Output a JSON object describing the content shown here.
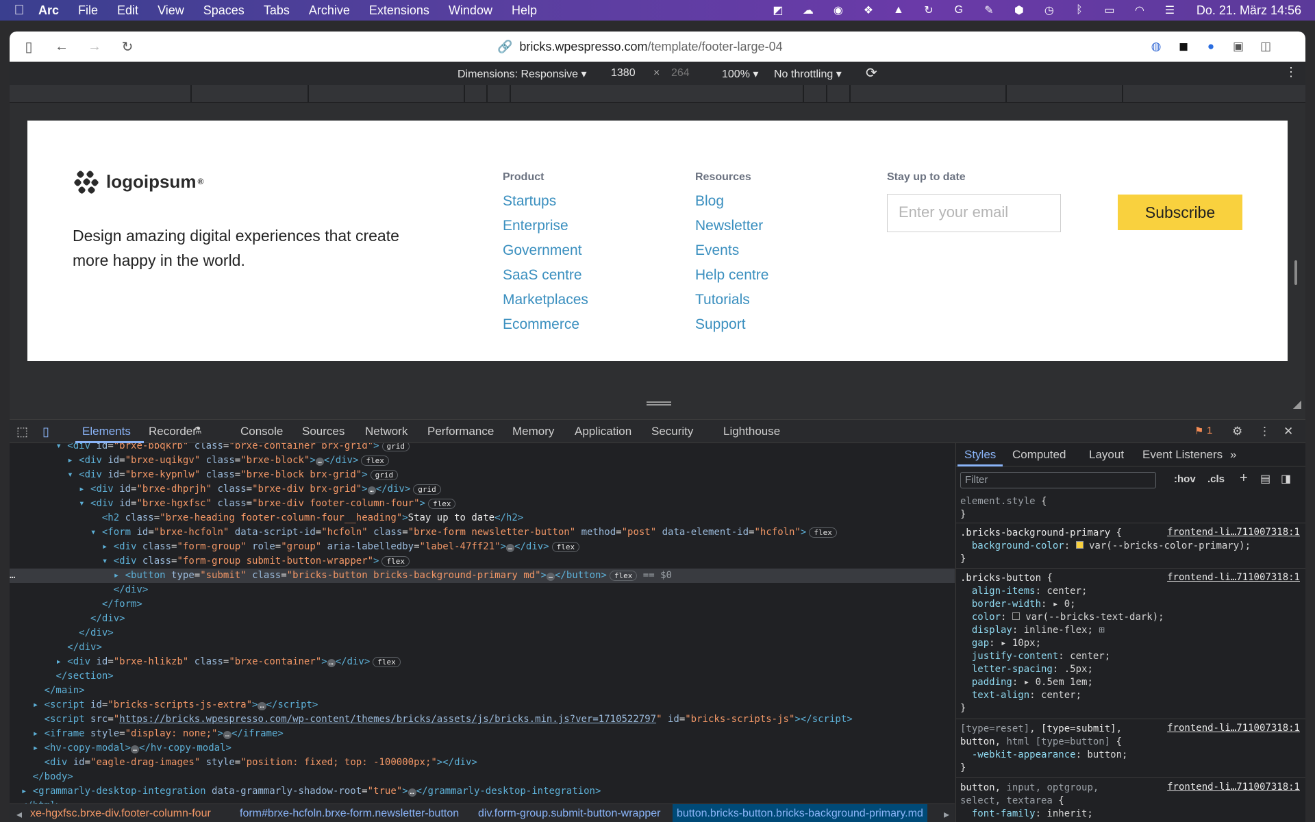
{
  "menubar": {
    "app": "Arc",
    "items": [
      "File",
      "Edit",
      "View",
      "Spaces",
      "Tabs",
      "Archive",
      "Extensions",
      "Window",
      "Help"
    ],
    "clock": "Do. 21. März  14:56"
  },
  "browser": {
    "url_host": "bricks.wpespresso.com",
    "url_path": "/template/footer-large-04"
  },
  "device_toolbar": {
    "dimensions": "Dimensions: Responsive ▾",
    "width": "1380",
    "times": "×",
    "height": "264",
    "zoom": "100% ▾",
    "throttle": "No throttling ▾"
  },
  "footer": {
    "logo": "logoipsum",
    "logo_mark": "®",
    "tagline": "Design amazing digital experiences that create more happy in the world.",
    "product_heading": "Product",
    "product_links": [
      "Startups",
      "Enterprise",
      "Government",
      "SaaS centre",
      "Marketplaces",
      "Ecommerce"
    ],
    "resources_heading": "Resources",
    "resources_links": [
      "Blog",
      "Newsletter",
      "Events",
      "Help centre",
      "Tutorials",
      "Support"
    ],
    "news_heading": "Stay up to date",
    "email_placeholder": "Enter your email",
    "subscribe": "Subscribe"
  },
  "devtools": {
    "tabs": [
      "Elements",
      "Recorder",
      "Console",
      "Sources",
      "Network",
      "Performance",
      "Memory",
      "Application",
      "Security",
      "Lighthouse"
    ],
    "issues": "1",
    "breadcrumbs": [
      "xe-hgxfsc.brxe-div.footer-column-four",
      "form#brxe-hcfoln.brxe-form.newsletter-button",
      "div.form-group.submit-button-wrapper",
      "button.bricks-button.bricks-background-primary.md"
    ],
    "styles_tabs": [
      "Styles",
      "Computed",
      "Layout",
      "Event Listeners",
      "»"
    ],
    "filter": "Filter",
    "hov": ":hov",
    "cls": ".cls",
    "source": "frontend-li…711007318:1"
  }
}
